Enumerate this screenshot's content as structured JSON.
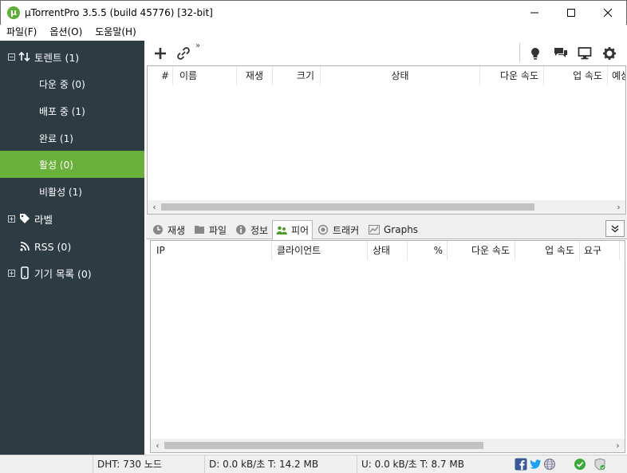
{
  "window": {
    "title": "µTorrentPro 3.5.5  (build 45776) [32-bit]",
    "app_icon_letter": "µ",
    "minimize": "—",
    "maximize": "☐",
    "close": "✕"
  },
  "menu": [
    {
      "label": "파일(F)"
    },
    {
      "label": "옵션(O)"
    },
    {
      "label": "도움말(H)"
    }
  ],
  "sidebar": {
    "torrents": {
      "label": "토렌트 (1)",
      "expander": "−"
    },
    "items": [
      {
        "label": "다운 중 (0)"
      },
      {
        "label": "배포 중 (1)"
      },
      {
        "label": "완료 (1)"
      },
      {
        "label": "활성 (0)"
      },
      {
        "label": "비활성 (1)"
      }
    ],
    "labels": {
      "label": "라벨",
      "expander": "+"
    },
    "rss": {
      "label": "RSS (0)"
    },
    "devices": {
      "label": "기기 목록 (0)",
      "expander": "+"
    }
  },
  "toolbar": {
    "more": "»"
  },
  "torrent_columns": [
    {
      "label": "#"
    },
    {
      "label": "이름"
    },
    {
      "label": "재생"
    },
    {
      "label": "크기"
    },
    {
      "label": "상태"
    },
    {
      "label": "다운 속도"
    },
    {
      "label": "업 속도"
    },
    {
      "label": "예상"
    }
  ],
  "scroll": {
    "left": "‹",
    "right": "›"
  },
  "tabs": [
    {
      "label": "재생"
    },
    {
      "label": "파일"
    },
    {
      "label": "정보"
    },
    {
      "label": "피어"
    },
    {
      "label": "트래커"
    },
    {
      "label": "Graphs"
    }
  ],
  "tab_collapse": "⌄⌄",
  "peer_columns": [
    {
      "label": "IP"
    },
    {
      "label": "클라이언트"
    },
    {
      "label": "상태"
    },
    {
      "label": "%"
    },
    {
      "label": "다운 속도"
    },
    {
      "label": "업 속도"
    },
    {
      "label": "요구"
    }
  ],
  "status": {
    "dht": "DHT: 730 노드",
    "down": "D: 0.0 kB/초 T: 14.2 MB",
    "up": "U: 0.0 kB/초 T: 8.7 MB"
  },
  "colors": {
    "sidebar_bg": "#2d3b43",
    "active_green": "#6ab13c",
    "facebook": "#3b5998",
    "twitter": "#1da1f2",
    "ok_green": "#3aa83a"
  }
}
